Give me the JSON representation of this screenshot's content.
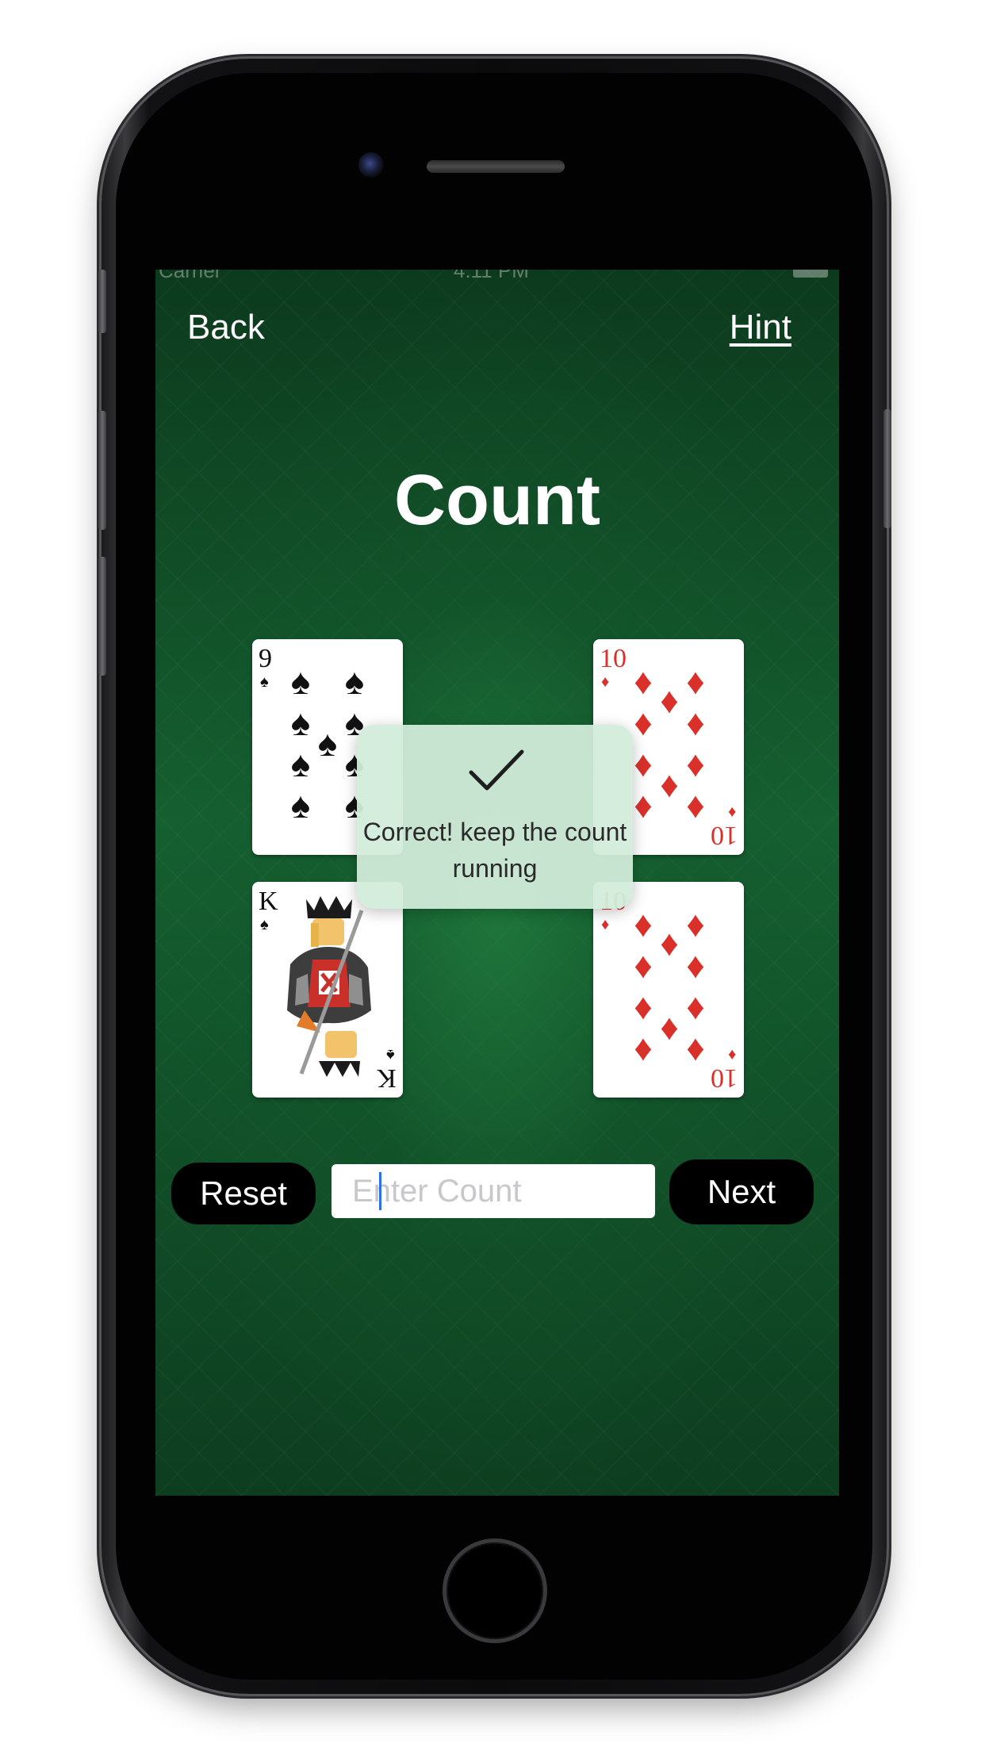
{
  "nav": {
    "back_label": "Back",
    "hint_label": "Hint"
  },
  "status_bar": {
    "carrier": "Carrier",
    "time": "4:11 PM"
  },
  "title": "Count",
  "cards": [
    {
      "rank": "9",
      "suit": "spades",
      "suit_symbol": "♠"
    },
    {
      "rank": "10",
      "suit": "diamonds",
      "suit_symbol": "♦"
    },
    {
      "rank": "K",
      "suit": "spades",
      "suit_symbol": "♠"
    },
    {
      "rank": "10",
      "suit": "diamonds",
      "suit_symbol": "♦"
    }
  ],
  "toast": {
    "icon": "checkmark-icon",
    "message": "Correct! keep the count running"
  },
  "controls": {
    "reset_label": "Reset",
    "next_label": "Next",
    "count_placeholder": "Enter Count",
    "count_value": ""
  },
  "colors": {
    "felt_green": "#155f30",
    "card_red": "#d9302a",
    "toast_bg": "#d2ecda"
  }
}
